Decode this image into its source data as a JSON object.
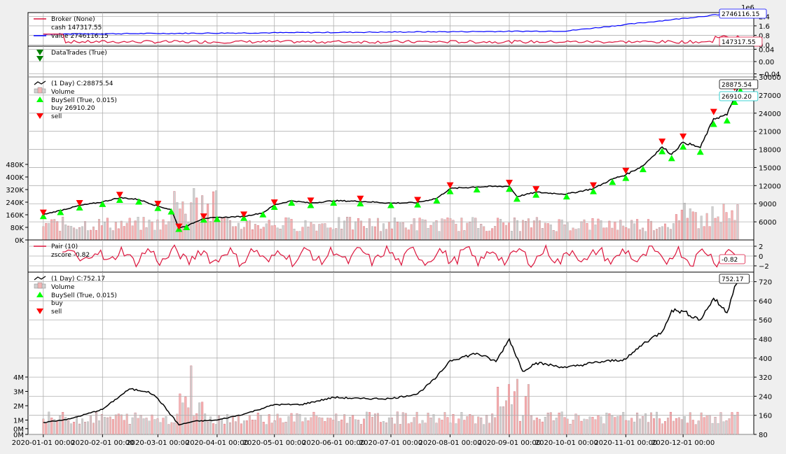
{
  "colors": {
    "broker": "#dc143c",
    "value": "#0000ff",
    "close": "#000000",
    "pair": "#dc143c",
    "buy": "#00ff00",
    "sell": "#ff0000",
    "datatrades": "#008000",
    "vol_up": "#f4b4b4",
    "vol_down": "#d0d0d0",
    "grid": "#b0b0b0"
  },
  "chart_data": [
    {
      "type": "line",
      "panel": "broker",
      "legend": [
        "Broker (None)",
        "cash 147317.55",
        "value 2746116.15"
      ],
      "series": [
        {
          "name": "cash",
          "values": [
            147317.55
          ]
        },
        {
          "name": "value",
          "values": [
            2746116.15
          ]
        }
      ],
      "y_exponent_label": "1e6",
      "yticks": [
        "2.4",
        "1.6",
        "0.8",
        "0.0"
      ],
      "ylim": [
        0,
        2.6
      ],
      "value_tags": [
        "2746116.15",
        "147317.55"
      ]
    },
    {
      "type": "scatter",
      "panel": "datatrades",
      "legend": [
        "DataTrades (True)"
      ],
      "yticks": [
        "0.04",
        "0.00",
        "−0.04"
      ],
      "ylim": [
        -0.05,
        0.05
      ]
    },
    {
      "type": "line",
      "panel": "data0",
      "legend": [
        " (1 Day) C:28875.54",
        "Volume",
        "BuySell (True, 0.015)",
        "buy 26910.20",
        "sell"
      ],
      "yticks": [
        "30000",
        "27000",
        "24000",
        "21000",
        "18000",
        "15000",
        "12000",
        "9000",
        "6000"
      ],
      "ylim": [
        3000,
        30000
      ],
      "volume_ticks": [
        "480K",
        "400K",
        "320K",
        "240K",
        "160K",
        "80K",
        "0K"
      ],
      "value_tags": [
        "28875.54",
        "26910.20"
      ],
      "close_points": [
        [
          "2020-01-01",
          7200
        ],
        [
          "2020-01-10",
          7900
        ],
        [
          "2020-01-20",
          8700
        ],
        [
          "2020-02-01",
          9300
        ],
        [
          "2020-02-10",
          10000
        ],
        [
          "2020-02-20",
          9700
        ],
        [
          "2020-03-01",
          8600
        ],
        [
          "2020-03-08",
          8000
        ],
        [
          "2020-03-12",
          5000
        ],
        [
          "2020-03-16",
          5300
        ],
        [
          "2020-03-25",
          6600
        ],
        [
          "2020-04-01",
          6700
        ],
        [
          "2020-04-15",
          6900
        ],
        [
          "2020-04-25",
          7500
        ],
        [
          "2020-05-01",
          8800
        ],
        [
          "2020-05-10",
          9500
        ],
        [
          "2020-05-20",
          9100
        ],
        [
          "2020-06-01",
          9500
        ],
        [
          "2020-06-15",
          9400
        ],
        [
          "2020-07-01",
          9100
        ],
        [
          "2020-07-15",
          9200
        ],
        [
          "2020-07-25",
          9900
        ],
        [
          "2020-08-01",
          11500
        ],
        [
          "2020-08-15",
          11800
        ],
        [
          "2020-09-01",
          11900
        ],
        [
          "2020-09-05",
          10200
        ],
        [
          "2020-09-15",
          10900
        ],
        [
          "2020-10-01",
          10600
        ],
        [
          "2020-10-15",
          11500
        ],
        [
          "2020-10-25",
          13100
        ],
        [
          "2020-11-01",
          13800
        ],
        [
          "2020-11-10",
          15300
        ],
        [
          "2020-11-20",
          18400
        ],
        [
          "2020-11-25",
          17200
        ],
        [
          "2020-12-01",
          19200
        ],
        [
          "2020-12-10",
          18300
        ],
        [
          "2020-12-17",
          23100
        ],
        [
          "2020-12-24",
          23700
        ],
        [
          "2020-12-28",
          26900
        ],
        [
          "2020-12-31",
          28875.54
        ]
      ]
    },
    {
      "type": "line",
      "panel": "pair",
      "legend": [
        "Pair (10)",
        "zscore -0.82"
      ],
      "yticks": [
        "2",
        "0",
        "−2"
      ],
      "ylim": [
        -3,
        3
      ],
      "value_tags": [
        "-0.82"
      ]
    },
    {
      "type": "line",
      "panel": "data1",
      "legend": [
        " (1 Day) C:752.17",
        "Volume",
        "BuySell (True, 0.015)",
        "buy",
        "sell"
      ],
      "yticks": [
        "720",
        "640",
        "560",
        "480",
        "400",
        "320",
        "240",
        "160",
        "80"
      ],
      "ylim": [
        80,
        760
      ],
      "volume_ticks": [
        "4M",
        "3M",
        "2M",
        "1M",
        "0M",
        "0M"
      ],
      "value_tags": [
        "752.17"
      ],
      "xticks": [
        "2020-01-01 00:00",
        "2020-02-01 00:00",
        "2020-03-01 00:00",
        "2020-04-01 00:00",
        "2020-05-01 00:00",
        "2020-06-01 00:00",
        "2020-07-01 00:00",
        "2020-08-01 00:00",
        "2020-09-01 00:00",
        "2020-10-01 00:00",
        "2020-11-01 00:00",
        "2020-12-01 00:00"
      ],
      "close_points": [
        [
          "2020-01-01",
          130
        ],
        [
          "2020-01-15",
          145
        ],
        [
          "2020-02-01",
          185
        ],
        [
          "2020-02-15",
          270
        ],
        [
          "2020-02-25",
          260
        ],
        [
          "2020-03-01",
          230
        ],
        [
          "2020-03-12",
          120
        ],
        [
          "2020-03-20",
          135
        ],
        [
          "2020-04-01",
          140
        ],
        [
          "2020-04-15",
          165
        ],
        [
          "2020-05-01",
          205
        ],
        [
          "2020-05-15",
          205
        ],
        [
          "2020-06-01",
          235
        ],
        [
          "2020-06-15",
          230
        ],
        [
          "2020-07-01",
          230
        ],
        [
          "2020-07-15",
          250
        ],
        [
          "2020-07-25",
          320
        ],
        [
          "2020-08-01",
          390
        ],
        [
          "2020-08-15",
          420
        ],
        [
          "2020-08-25",
          385
        ],
        [
          "2020-09-01",
          480
        ],
        [
          "2020-09-08",
          345
        ],
        [
          "2020-09-15",
          380
        ],
        [
          "2020-10-01",
          360
        ],
        [
          "2020-10-15",
          380
        ],
        [
          "2020-11-01",
          395
        ],
        [
          "2020-11-10",
          460
        ],
        [
          "2020-11-20",
          510
        ],
        [
          "2020-11-25",
          600
        ],
        [
          "2020-12-01",
          595
        ],
        [
          "2020-12-10",
          560
        ],
        [
          "2020-12-17",
          650
        ],
        [
          "2020-12-24",
          590
        ],
        [
          "2020-12-28",
          700
        ],
        [
          "2020-12-31",
          752.17
        ]
      ]
    }
  ]
}
